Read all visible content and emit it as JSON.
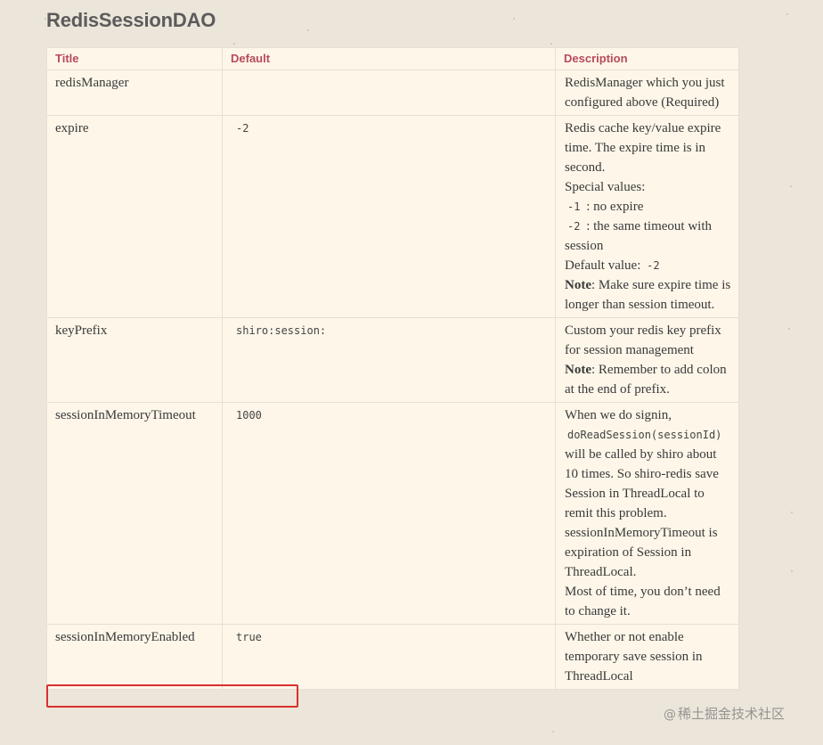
{
  "heading": "RedisSessionDAO",
  "table": {
    "headers": {
      "title": "Title",
      "default": "Default",
      "description": "Description"
    },
    "rows": [
      {
        "title": "redisManager",
        "default": "",
        "description": [
          {
            "text": "RedisManager which you just configured above (Required)"
          }
        ]
      },
      {
        "title": "expire",
        "default": "-2",
        "description": [
          {
            "text": "Redis cache key/value expire time. The expire time is in second."
          },
          {
            "text": "Special values:"
          },
          {
            "code": "-1",
            "text": " : no expire"
          },
          {
            "code": "-2",
            "text": " : the same timeout with session"
          },
          {
            "text": "Default value:  ",
            "code_after": "-2"
          },
          {
            "bold": "Note",
            "text": ": Make sure expire time is longer than session timeout."
          }
        ]
      },
      {
        "title": "keyPrefix",
        "default": "shiro:session:",
        "description": [
          {
            "text": "Custom your redis key prefix for session management"
          },
          {
            "bold": "Note",
            "text": ": Remember to add colon at the end of prefix."
          }
        ]
      },
      {
        "title": "sessionInMemoryTimeout",
        "default": "1000",
        "description": [
          {
            "text": "When we do signin,"
          },
          {
            "code": "doReadSession(sessionId)",
            "text": ""
          },
          {
            "text": "will be called by shiro about 10 times. So shiro-redis save Session in ThreadLocal to remit this problem. sessionInMemoryTimeout is expiration of Session in ThreadLocal."
          },
          {
            "text": "Most of time, you don’t need to change it."
          }
        ]
      },
      {
        "title": "sessionInMemoryEnabled",
        "default": "true",
        "description": [
          {
            "text": "Whether or not enable temporary save session in ThreadLocal"
          }
        ]
      }
    ]
  },
  "watermark": {
    "at": "@",
    "text": "稀土掘金技术社区"
  }
}
